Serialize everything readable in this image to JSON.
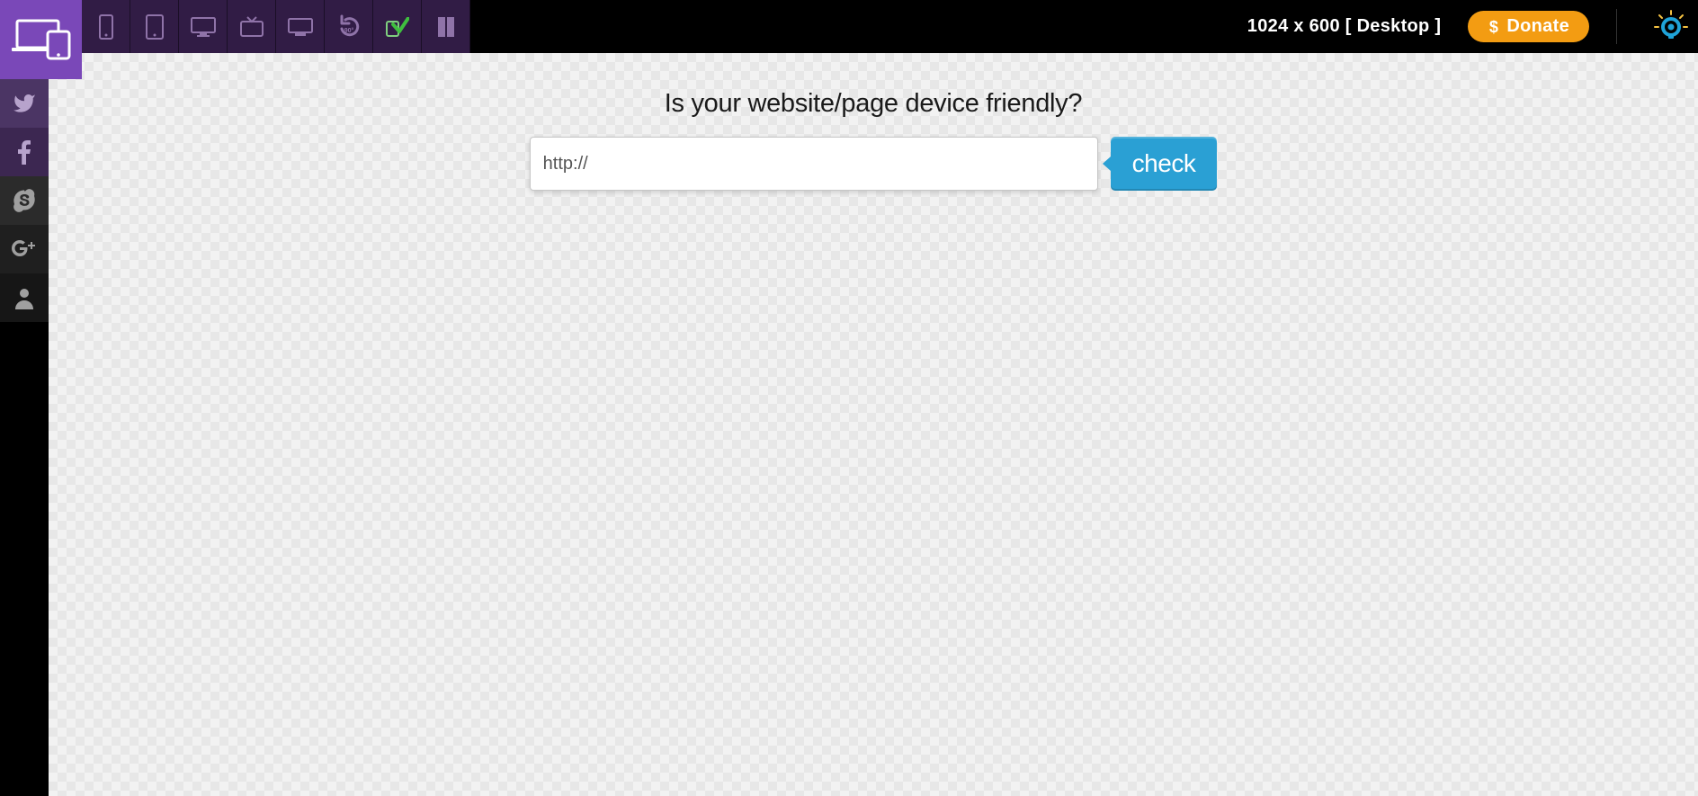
{
  "topbar": {
    "nav": {
      "logo_name": "multi-device-logo",
      "phone": "phone-icon",
      "tablet": "tablet-icon",
      "desktop": "desktop-icon",
      "tv": "tv-icon",
      "widescreen": "widescreen-icon",
      "rotate": "rotate-90-icon",
      "check": "check-icon",
      "book": "book-icon"
    },
    "dimensions_text": "1024 x 600 [ Desktop ]",
    "donate_label": "Donate",
    "tip_name": "lightbulb-icon"
  },
  "sidebar": {
    "twitter": "twitter-icon",
    "facebook": "facebook-icon",
    "skype": "skype-icon",
    "gplus": "google-plus-icon",
    "user": "user-icon"
  },
  "hero": {
    "heading": "Is your website/page device friendly?",
    "url_value": "http://",
    "check_label": "check"
  }
}
